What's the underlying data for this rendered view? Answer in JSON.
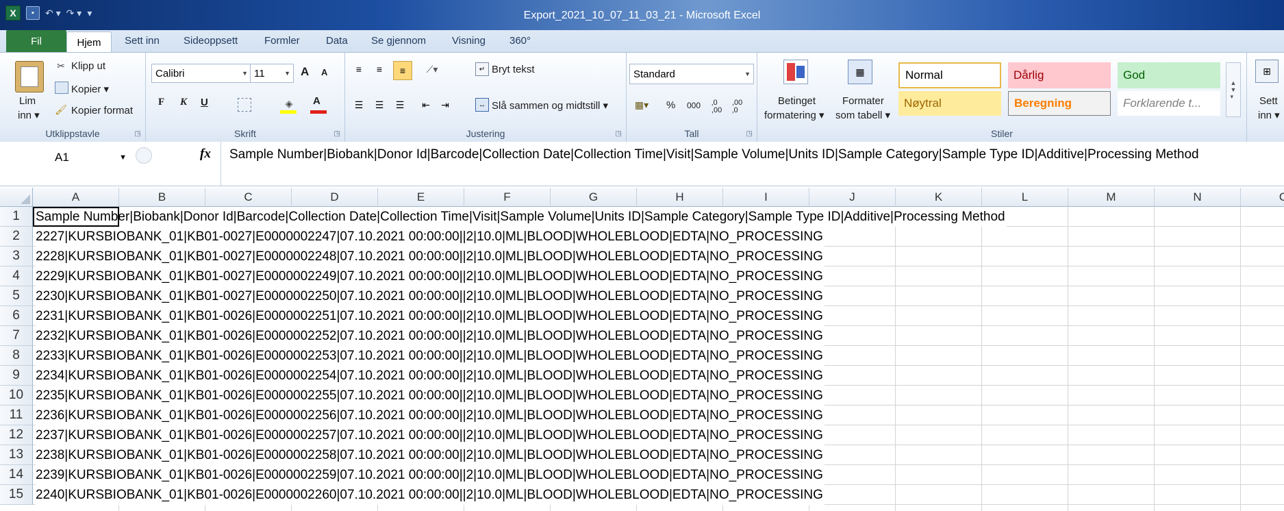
{
  "window": {
    "title": "Export_2021_10_07_11_03_21  -  Microsoft Excel",
    "app_icon": "X"
  },
  "tabs": {
    "file": "Fil",
    "items": [
      "Hjem",
      "Sett inn",
      "Sideoppsett",
      "Formler",
      "Data",
      "Se gjennom",
      "Visning",
      "360°"
    ],
    "active": "Hjem"
  },
  "ribbon": {
    "clipboard": {
      "paste_line1": "Lim",
      "paste_line2": "inn ▾",
      "cut": "Klipp ut",
      "copy": "Kopier ▾",
      "format_painter": "Kopier format",
      "label": "Utklippstavle"
    },
    "font": {
      "name": "Calibri",
      "size": "11",
      "bold": "F",
      "italic": "K",
      "underline": "U",
      "grow": "A",
      "shrink": "A",
      "label": "Skrift",
      "fill_color": "#ffff00",
      "text_color": "#e0201a"
    },
    "alignment": {
      "wrap": "Bryt tekst",
      "merge": "Slå sammen og midtstill ▾",
      "label": "Justering"
    },
    "number": {
      "format": "Standard",
      "percent": "%",
      "thousands": "000",
      "inc_decimal": "‚0 ,00",
      "dec_decimal": ",00 ‚0",
      "label": "Tall"
    },
    "styles": {
      "cond_line1": "Betinget",
      "cond_line2": "formatering ▾",
      "table_line1": "Formater",
      "table_line2": "som tabell ▾",
      "cells": [
        {
          "name": "Normal",
          "bg": "#ffffff",
          "fg": "#000000"
        },
        {
          "name": "Dårlig",
          "bg": "#ffc7ce",
          "fg": "#9c0006"
        },
        {
          "name": "God",
          "bg": "#c6efce",
          "fg": "#006100"
        },
        {
          "name": "Nøytral",
          "bg": "#ffeb9c",
          "fg": "#9c6500"
        },
        {
          "name": "Beregning",
          "bg": "#f2f2f2",
          "fg": "#fa7d00"
        },
        {
          "name": "Forklarende t...",
          "bg": "#ffffff",
          "fg": "#7f7f7f"
        }
      ],
      "label": "Stiler"
    },
    "cells_group": {
      "insert_line1": "Sett",
      "insert_line2": "inn ▾"
    }
  },
  "formula_bar": {
    "name_box": "A1",
    "fx": "fx",
    "content": "Sample Number|Biobank|Donor Id|Barcode|Collection Date|Collection Time|Visit|Sample Volume|Units ID|Sample Category|Sample Type ID|Additive|Processing Method"
  },
  "sheet": {
    "columns": [
      "A",
      "B",
      "C",
      "D",
      "E",
      "F",
      "G",
      "H",
      "I",
      "J",
      "K",
      "L",
      "M",
      "N",
      "O"
    ],
    "rows": [
      {
        "n": "1",
        "text": "Sample Number|Biobank|Donor Id|Barcode|Collection Date|Collection Time|Visit|Sample Volume|Units ID|Sample Category|Sample Type ID|Additive|Processing Method"
      },
      {
        "n": "2",
        "text": "2227|KURSBIOBANK_01|KB01-0027|E0000002247|07.10.2021 00:00:00||2|10.0|ML|BLOOD|WHOLEBLOOD|EDTA|NO_PROCESSING"
      },
      {
        "n": "3",
        "text": "2228|KURSBIOBANK_01|KB01-0027|E0000002248|07.10.2021 00:00:00||2|10.0|ML|BLOOD|WHOLEBLOOD|EDTA|NO_PROCESSING"
      },
      {
        "n": "4",
        "text": "2229|KURSBIOBANK_01|KB01-0027|E0000002249|07.10.2021 00:00:00||2|10.0|ML|BLOOD|WHOLEBLOOD|EDTA|NO_PROCESSING"
      },
      {
        "n": "5",
        "text": "2230|KURSBIOBANK_01|KB01-0027|E0000002250|07.10.2021 00:00:00||2|10.0|ML|BLOOD|WHOLEBLOOD|EDTA|NO_PROCESSING"
      },
      {
        "n": "6",
        "text": "2231|KURSBIOBANK_01|KB01-0026|E0000002251|07.10.2021 00:00:00||2|10.0|ML|BLOOD|WHOLEBLOOD|EDTA|NO_PROCESSING"
      },
      {
        "n": "7",
        "text": "2232|KURSBIOBANK_01|KB01-0026|E0000002252|07.10.2021 00:00:00||2|10.0|ML|BLOOD|WHOLEBLOOD|EDTA|NO_PROCESSING"
      },
      {
        "n": "8",
        "text": "2233|KURSBIOBANK_01|KB01-0026|E0000002253|07.10.2021 00:00:00||2|10.0|ML|BLOOD|WHOLEBLOOD|EDTA|NO_PROCESSING"
      },
      {
        "n": "9",
        "text": "2234|KURSBIOBANK_01|KB01-0026|E0000002254|07.10.2021 00:00:00||2|10.0|ML|BLOOD|WHOLEBLOOD|EDTA|NO_PROCESSING"
      },
      {
        "n": "10",
        "text": "2235|KURSBIOBANK_01|KB01-0026|E0000002255|07.10.2021 00:00:00||2|10.0|ML|BLOOD|WHOLEBLOOD|EDTA|NO_PROCESSING"
      },
      {
        "n": "11",
        "text": "2236|KURSBIOBANK_01|KB01-0026|E0000002256|07.10.2021 00:00:00||2|10.0|ML|BLOOD|WHOLEBLOOD|EDTA|NO_PROCESSING"
      },
      {
        "n": "12",
        "text": "2237|KURSBIOBANK_01|KB01-0026|E0000002257|07.10.2021 00:00:00||2|10.0|ML|BLOOD|WHOLEBLOOD|EDTA|NO_PROCESSING"
      },
      {
        "n": "13",
        "text": "2238|KURSBIOBANK_01|KB01-0026|E0000002258|07.10.2021 00:00:00||2|10.0|ML|BLOOD|WHOLEBLOOD|EDTA|NO_PROCESSING"
      },
      {
        "n": "14",
        "text": "2239|KURSBIOBANK_01|KB01-0026|E0000002259|07.10.2021 00:00:00||2|10.0|ML|BLOOD|WHOLEBLOOD|EDTA|NO_PROCESSING"
      },
      {
        "n": "15",
        "text": "2240|KURSBIOBANK_01|KB01-0026|E0000002260|07.10.2021 00:00:00||2|10.0|ML|BLOOD|WHOLEBLOOD|EDTA|NO_PROCESSING"
      }
    ]
  }
}
